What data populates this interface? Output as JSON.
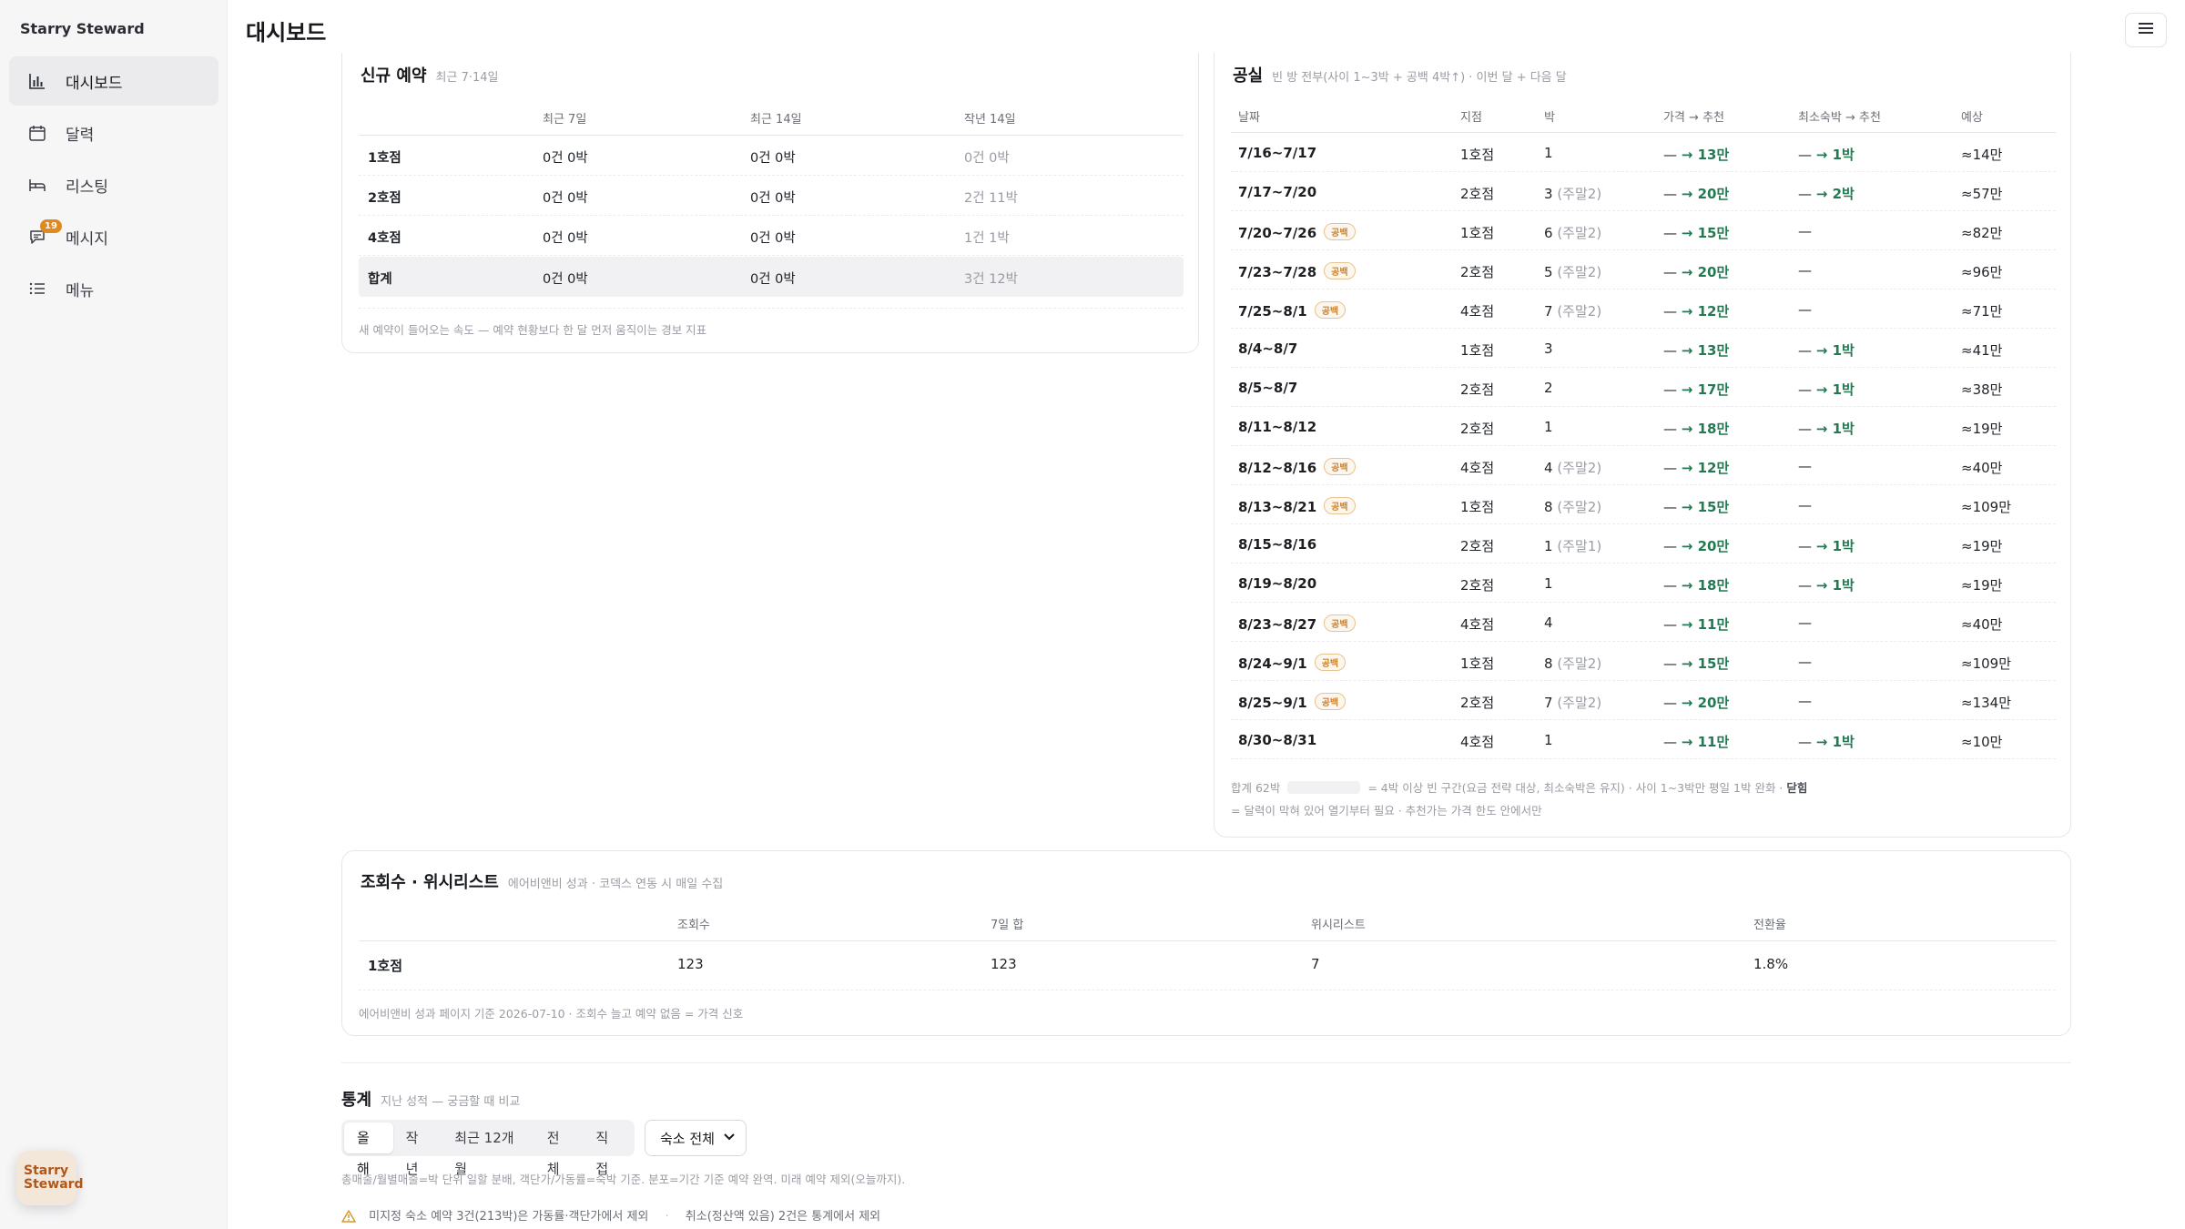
{
  "app": {
    "brand": "Starry Steward",
    "page_title": "대시보드"
  },
  "sidebar": {
    "items": [
      {
        "label": "대시보드",
        "icon": "bar-chart-icon",
        "active": true
      },
      {
        "label": "달력",
        "icon": "calendar-icon"
      },
      {
        "label": "리스팅",
        "icon": "bed-icon"
      },
      {
        "label": "메시지",
        "icon": "chat-icon",
        "badge": "19"
      },
      {
        "label": "메뉴",
        "icon": "list-icon"
      }
    ],
    "fab_line1": "Starry",
    "fab_line2": "Steward"
  },
  "new_bookings": {
    "title": "신규 예약",
    "subtitle": "최근 7·14일",
    "headers": [
      "최근 7일",
      "최근 14일",
      "작년 14일"
    ],
    "rows": [
      {
        "name": "1호점",
        "c7": "0건 0박",
        "c14": "0건 0박",
        "ly": "0건 0박"
      },
      {
        "name": "2호점",
        "c7": "0건 0박",
        "c14": "0건 0박",
        "ly": "2건 11박"
      },
      {
        "name": "4호점",
        "c7": "0건 0박",
        "c14": "0건 0박",
        "ly": "1건 1박"
      },
      {
        "name": "합계",
        "c7": "0건 0박",
        "c14": "0건 0박",
        "ly": "3건 12박"
      }
    ],
    "footnote": "새 예약이 들어오는 속도 — 예약 현황보다 한 달 먼저 움직이는 경보 지표"
  },
  "vacancy": {
    "title": "공실",
    "subtitle": "빈 방 전부(사이 1~3박 + 공백 4박↑) · 이번 달 + 다음 달",
    "headers": [
      "날짜",
      "지점",
      "박",
      "가격 → 추천",
      "최소숙박 → 추천",
      "예상"
    ],
    "gap_label": "공백",
    "rows": [
      {
        "date": "7/16~7/17",
        "gap": false,
        "branch": "1호점",
        "nights": "1",
        "weekend": "",
        "price": "— → 13만",
        "minstay": "— → 1박",
        "est": "≈14만"
      },
      {
        "date": "7/17~7/20",
        "gap": false,
        "branch": "2호점",
        "nights": "3",
        "weekend": "(주말2)",
        "price": "— → 20만",
        "minstay": "— → 2박",
        "est": "≈57만"
      },
      {
        "date": "7/20~7/26",
        "gap": true,
        "branch": "1호점",
        "nights": "6",
        "weekend": "(주말2)",
        "price": "— → 15만",
        "minstay": "—",
        "est": "≈82만"
      },
      {
        "date": "7/23~7/28",
        "gap": true,
        "branch": "2호점",
        "nights": "5",
        "weekend": "(주말2)",
        "price": "— → 20만",
        "minstay": "—",
        "est": "≈96만"
      },
      {
        "date": "7/25~8/1",
        "gap": true,
        "branch": "4호점",
        "nights": "7",
        "weekend": "(주말2)",
        "price": "— → 12만",
        "minstay": "—",
        "est": "≈71만"
      },
      {
        "date": "8/4~8/7",
        "gap": false,
        "branch": "1호점",
        "nights": "3",
        "weekend": "",
        "price": "— → 13만",
        "minstay": "— → 1박",
        "est": "≈41만"
      },
      {
        "date": "8/5~8/7",
        "gap": false,
        "branch": "2호점",
        "nights": "2",
        "weekend": "",
        "price": "— → 17만",
        "minstay": "— → 1박",
        "est": "≈38만"
      },
      {
        "date": "8/11~8/12",
        "gap": false,
        "branch": "2호점",
        "nights": "1",
        "weekend": "",
        "price": "— → 18만",
        "minstay": "— → 1박",
        "est": "≈19만"
      },
      {
        "date": "8/12~8/16",
        "gap": true,
        "branch": "4호점",
        "nights": "4",
        "weekend": "(주말2)",
        "price": "— → 12만",
        "minstay": "—",
        "est": "≈40만"
      },
      {
        "date": "8/13~8/21",
        "gap": true,
        "branch": "1호점",
        "nights": "8",
        "weekend": "(주말2)",
        "price": "— → 15만",
        "minstay": "—",
        "est": "≈109만"
      },
      {
        "date": "8/15~8/16",
        "gap": false,
        "branch": "2호점",
        "nights": "1",
        "weekend": "(주말1)",
        "price": "— → 20만",
        "minstay": "— → 1박",
        "est": "≈19만"
      },
      {
        "date": "8/19~8/20",
        "gap": false,
        "branch": "2호점",
        "nights": "1",
        "weekend": "",
        "price": "— → 18만",
        "minstay": "— → 1박",
        "est": "≈19만"
      },
      {
        "date": "8/23~8/27",
        "gap": true,
        "branch": "4호점",
        "nights": "4",
        "weekend": "",
        "price": "— → 11만",
        "minstay": "—",
        "est": "≈40만"
      },
      {
        "date": "8/24~9/1",
        "gap": true,
        "branch": "1호점",
        "nights": "8",
        "weekend": "(주말2)",
        "price": "— → 15만",
        "minstay": "—",
        "est": "≈109만"
      },
      {
        "date": "8/25~9/1",
        "gap": true,
        "branch": "2호점",
        "nights": "7",
        "weekend": "(주말2)",
        "price": "— → 20만",
        "minstay": "—",
        "est": "≈134만"
      },
      {
        "date": "8/30~8/31",
        "gap": false,
        "branch": "4호점",
        "nights": "1",
        "weekend": "",
        "price": "— → 11만",
        "minstay": "— → 1박",
        "est": "≈10만"
      }
    ],
    "summary_prefix": "합계 62박",
    "summary_rest": "= 4박 이상 빈 구간(요금 전략 대상, 최소숙박은 유지) · 사이 1~3박만 평일 1박 완화 ·",
    "summary_link": "닫힘",
    "summary_line2": "= 달력이 막혀 있어 열기부터 필요 · 추천가는 가격 한도 안에서만"
  },
  "views": {
    "title": "조회수 · 위시리스트",
    "subtitle": "에어비앤비 성과 · 코덱스 연동 시 매일 수집",
    "headers": [
      "조회수",
      "7일 합",
      "위시리스트",
      "전환율"
    ],
    "rows": [
      {
        "name": "1호점",
        "views": "123",
        "sum7": "123",
        "wish": "7",
        "conv": "1.8%"
      }
    ],
    "footnote": "에어비앤비 성과 페이지 기준 2026-07-10 · 조회수 늘고 예약 없음 = 가격 신호"
  },
  "stats": {
    "title": "통계",
    "subtitle": "지난 성적 — 궁금할 때 비교",
    "tabs": [
      "올해",
      "작년",
      "최근 12개월",
      "전체",
      "직접"
    ],
    "active_tab": "올해",
    "select_value": "숙소 전체",
    "note": "총매출/월별매출=박 단위 일할 분배, 객단가/가동률=숙박 기준. 분포=기간 기준 예약 완역. 미래 예약 제외(오늘까지).",
    "warning1": "미지정 숙소 예약 3건(213박)은 가동률·객단가에서 제외",
    "warning2": "취소(정산액 있음) 2건은 통계에서 제외"
  },
  "colors": {
    "accent_green": "#237a52",
    "badge_orange": "#e08a1e",
    "gap_tag": "#c98433",
    "fab_text": "#b2571a"
  }
}
